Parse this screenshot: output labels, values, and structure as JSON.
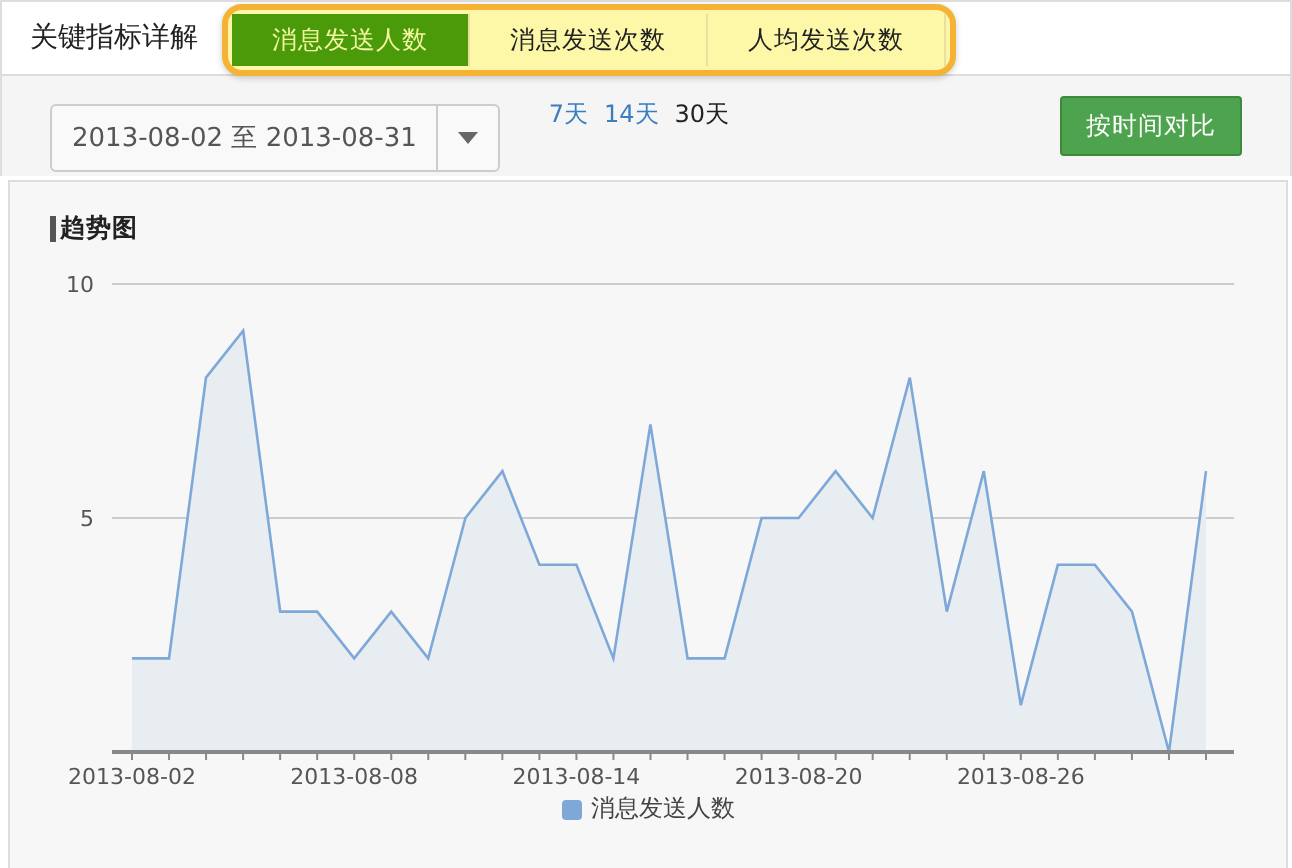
{
  "header": {
    "title": "关键指标详解"
  },
  "tabs": [
    {
      "label": "消息发送人数",
      "selected": true
    },
    {
      "label": "消息发送次数",
      "selected": false
    },
    {
      "label": "人均发送次数",
      "selected": false
    }
  ],
  "toolbar": {
    "date_range": "2013-08-02 至 2013-08-31",
    "ranges": [
      {
        "label": "7天",
        "selected": false
      },
      {
        "label": "14天",
        "selected": false
      },
      {
        "label": "30天",
        "selected": true
      }
    ],
    "compare_button": "按时间对比"
  },
  "trend": {
    "title": "趋势图",
    "chart_data": {
      "type": "area",
      "series": [
        {
          "name": "消息发送人数",
          "color": "#7ea8d8",
          "values": [
            2,
            2,
            8,
            9,
            3,
            3,
            2,
            3,
            2,
            5,
            6,
            4,
            4,
            2,
            7,
            2,
            2,
            5,
            5,
            6,
            5,
            8,
            3,
            6,
            1,
            4,
            4,
            3,
            0,
            6
          ]
        }
      ],
      "ylim": [
        0,
        10
      ],
      "yticks": [
        5,
        10
      ],
      "categories": [
        "2013-08-02",
        null,
        null,
        null,
        null,
        null,
        "2013-08-08",
        null,
        null,
        null,
        null,
        null,
        "2013-08-14",
        null,
        null,
        null,
        null,
        null,
        "2013-08-20",
        null,
        null,
        null,
        null,
        null,
        "2013-08-26",
        null,
        null,
        null,
        null,
        null
      ]
    }
  }
}
